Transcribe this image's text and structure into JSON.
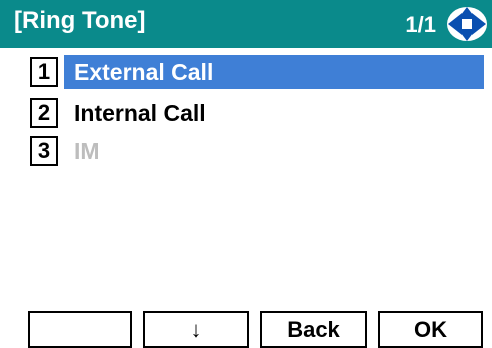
{
  "header": {
    "title": "[Ring Tone]",
    "page_indicator": "1/1",
    "nav_icon": "navigation-cursor-icon"
  },
  "colors": {
    "header_bg": "#0a8a8b",
    "selected_bg": "#3f7fd6",
    "disabled_text": "#bdbdbd"
  },
  "menu": {
    "items": [
      {
        "number": "1",
        "label": "External Call",
        "state": "selected"
      },
      {
        "number": "2",
        "label": "Internal Call",
        "state": "normal"
      },
      {
        "number": "3",
        "label": "IM",
        "state": "disabled"
      }
    ]
  },
  "softkeys": {
    "key1": "",
    "key2": "↓",
    "key3": "Back",
    "key4": "OK"
  }
}
